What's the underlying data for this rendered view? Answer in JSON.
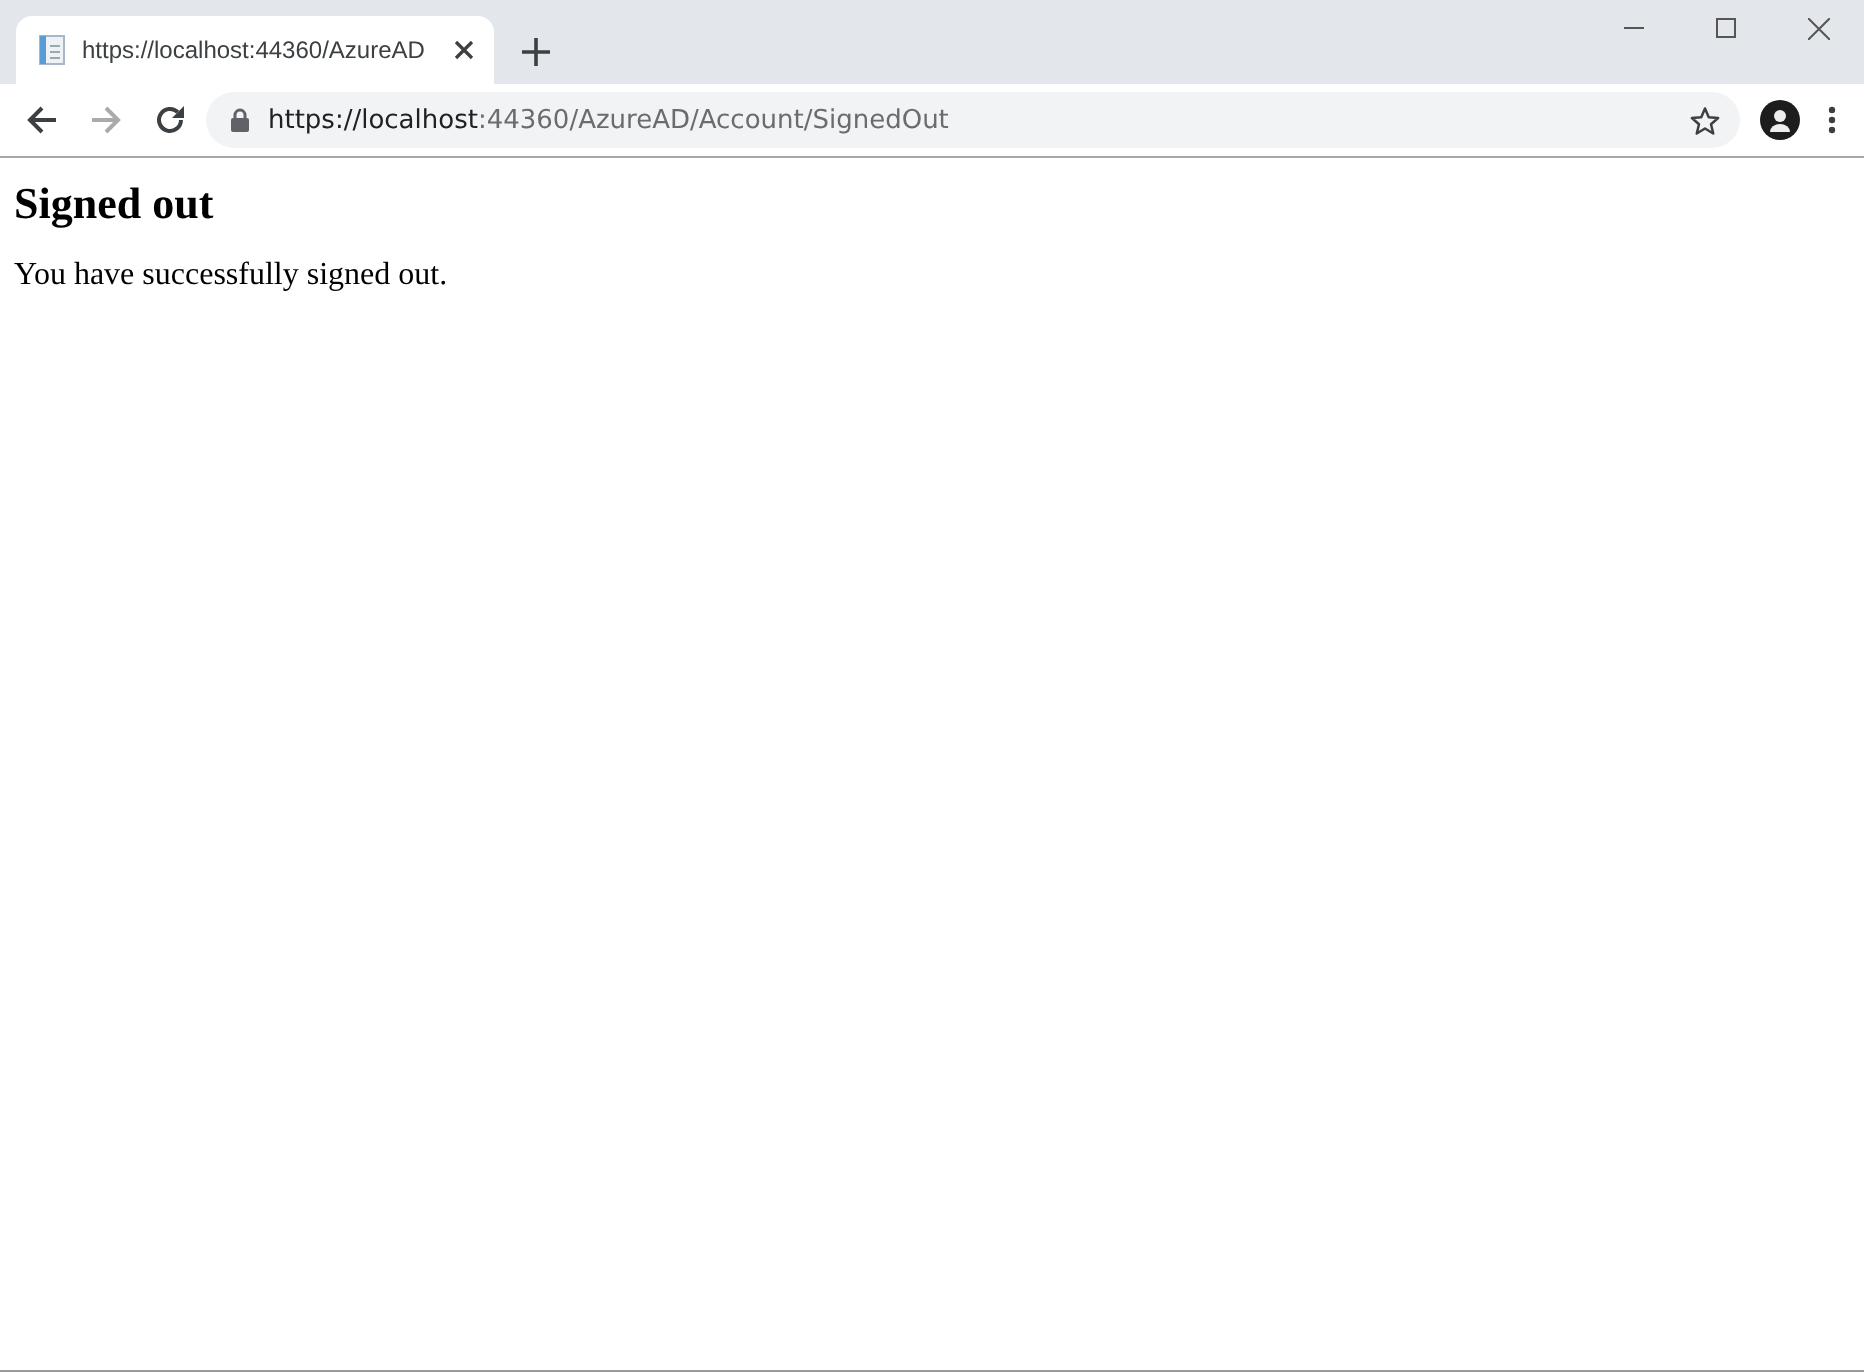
{
  "tabs": [
    {
      "title": "https://localhost:44360/AzureAD",
      "selected": true
    }
  ],
  "address_bar": {
    "url_host": "https://localhost",
    "url_rest": ":44360/AzureAD/Account/SignedOut"
  },
  "page": {
    "heading": "Signed out",
    "message": "You have successfully signed out."
  }
}
